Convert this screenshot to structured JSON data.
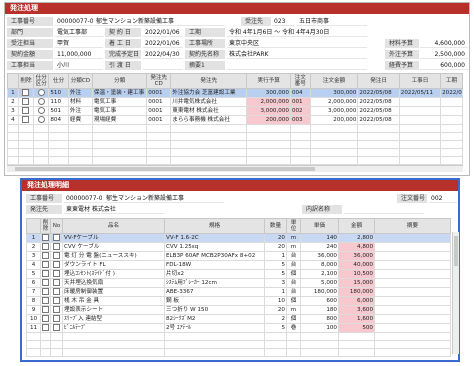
{
  "order_window": {
    "title": "発注処理",
    "header": {
      "construction_no_label": "工事番号",
      "construction_no": "00000077-0",
      "construction_name": "郁生マンション新築設備工事",
      "order_to_label": "受注先",
      "order_to_code": "023",
      "order_to_name": "五日市商事",
      "dept_label": "部門",
      "dept": "電気工事部",
      "contract_date_label": "契 約 日",
      "contract_date": "2022/01/06",
      "period_label": "工期",
      "period": "令和 4年1月6日 ～ 令和 4年4月30日",
      "owner_label": "受注担当",
      "owner": "甲賀",
      "start_label": "着 工 日",
      "start": "2022/01/06",
      "site_label": "工事場所",
      "site": "東京中央区",
      "material_label": "材料予算",
      "material": "4,600,000",
      "amount_label": "契約金額",
      "amount": "11,000,000",
      "completion_label": "完成予定日",
      "completion": "2022/04/30",
      "client_label": "契約先名称",
      "client": "株式会社PARK",
      "outsourcing_label": "外注予算",
      "outsourcing": "2,500,000",
      "staff_label": "工事担当",
      "staff": "小川",
      "handover_label": "引 渡 日",
      "handover": "",
      "memo_label": "摘要1",
      "memo": "",
      "expense_label": "経費予算",
      "expense": "600,000"
    },
    "columns": [
      "削除",
      "仕分区分",
      "仕分",
      "分類CD",
      "分類",
      "発注先CD",
      "発注先",
      "実行予算",
      "注文番号",
      "注文金額",
      "発注日",
      "工事日",
      "工期"
    ],
    "rows": [
      {
        "no": "1",
        "code": "510",
        "class_cd": "外注",
        "class_name": "保温・塗装・建工事",
        "vendor_cd": "0001",
        "vendor": "外注協力会 芝富建設工業",
        "budget": "300,000",
        "order_no": "004",
        "order_amount": "300,000",
        "order_date": "2022/05/08",
        "work_date": "2022/05/11",
        "term": "2022/0"
      },
      {
        "no": "2",
        "code": "110",
        "class_cd": "材料",
        "class_name": "電気工事",
        "vendor_cd": "0001",
        "vendor": "川井電気株式会社",
        "budget": "2,000,000",
        "order_no": "001",
        "order_amount": "2,000,000",
        "order_date": "2022/05/08",
        "work_date": "",
        "term": ""
      },
      {
        "no": "3",
        "code": "501",
        "class_cd": "外注",
        "class_name": "電気工事",
        "vendor_cd": "0001",
        "vendor": "東東電材 株式会社",
        "budget": "3,000,000",
        "order_no": "002",
        "order_amount": "3,000,000",
        "order_date": "2022/05/08",
        "work_date": "",
        "term": ""
      },
      {
        "no": "4",
        "code": "804",
        "class_cd": "経費",
        "class_name": "現場経費",
        "vendor_cd": "0001",
        "vendor": "まらら事務機 株式会社",
        "budget": "200,000",
        "order_no": "003",
        "order_amount": "200,000",
        "order_date": "2022/05/08",
        "work_date": "",
        "term": ""
      }
    ]
  },
  "detail_window": {
    "title": "発注処理明細",
    "construction_no_label": "工事番号",
    "construction_no": "00000077-0",
    "construction_name": "郁生マンション新築設備工事",
    "order_no_label": "注文番号",
    "order_no": "002",
    "vendor_label": "発注先",
    "vendor": "東東電材 株式会社",
    "internal_label": "内訳名称",
    "internal": "",
    "columns": [
      "削除",
      "No",
      "品名",
      "規格",
      "数量",
      "単位",
      "単価",
      "金額",
      "摘要"
    ],
    "rows": [
      {
        "no": "1",
        "name": "VV-Fケーブル",
        "spec": "VV-F 1.6-2C",
        "qty": "20",
        "unit": "m",
        "price": "140",
        "amount": "2,800",
        "note": ""
      },
      {
        "no": "2",
        "name": "CVV ケーブル",
        "spec": "CVV 1.25sq",
        "qty": "20",
        "unit": "m",
        "price": "240",
        "amount": "4,800",
        "note": ""
      },
      {
        "no": "3",
        "name": "電 灯 分 電 盤(ニューススキ)",
        "spec": "ELB3P 60AF MCB2P30AFx 8+02",
        "qty": "1",
        "unit": "台",
        "price": "36,000",
        "amount": "36,000",
        "note": ""
      },
      {
        "no": "4",
        "name": "ダウンライト FL",
        "spec": "FDL-18W",
        "qty": "5",
        "unit": "台",
        "price": "8,000",
        "amount": "40,000",
        "note": ""
      },
      {
        "no": "5",
        "name": "埋込ｺﾝｾﾝﾄ(ｽﾗｲﾄﾞ付 )",
        "spec": "片切x2",
        "qty": "5",
        "unit": "個",
        "price": "2,100",
        "amount": "10,500",
        "note": ""
      },
      {
        "no": "6",
        "name": "天井埋込換気扇",
        "spec": "ｼｽﾃﾑ用ﾌﾞﾚｰｶｰ 12cm",
        "qty": "3",
        "unit": "台",
        "price": "5,000",
        "amount": "15,000",
        "note": ""
      },
      {
        "no": "7",
        "name": "床暖房制御装置",
        "spec": "ABE-3367",
        "qty": "1",
        "unit": "台",
        "price": "180,000",
        "amount": "180,000",
        "note": ""
      },
      {
        "no": "8",
        "name": "桟 木 吊 金 具",
        "spec": "鋼  板",
        "qty": "10",
        "unit": "個",
        "price": "600",
        "amount": "6,000",
        "note": ""
      },
      {
        "no": "9",
        "name": "埋設表示シート",
        "spec": "三つ折り W 150",
        "qty": "20",
        "unit": "m",
        "price": "180",
        "amount": "3,600",
        "note": ""
      },
      {
        "no": "10",
        "name": "ｽﾘｰﾌﾞ入 連結型",
        "spec": "82ｼｰｸｽﾞM2",
        "qty": "2",
        "unit": "個",
        "price": "800",
        "amount": "1,600",
        "note": ""
      },
      {
        "no": "11",
        "name": "ﾋﾞﾆﾙﾃｰﾌﾟ",
        "spec": "2号 ｴｱﾃｰﾙ",
        "qty": "5",
        "unit": "巻",
        "price": "100",
        "amount": "500",
        "note": ""
      }
    ]
  },
  "colors": {
    "titlebar": "#b8302a",
    "highlight": "#f7c9cf",
    "selected": "#b8cff0",
    "frame": "#3a6bd0"
  }
}
